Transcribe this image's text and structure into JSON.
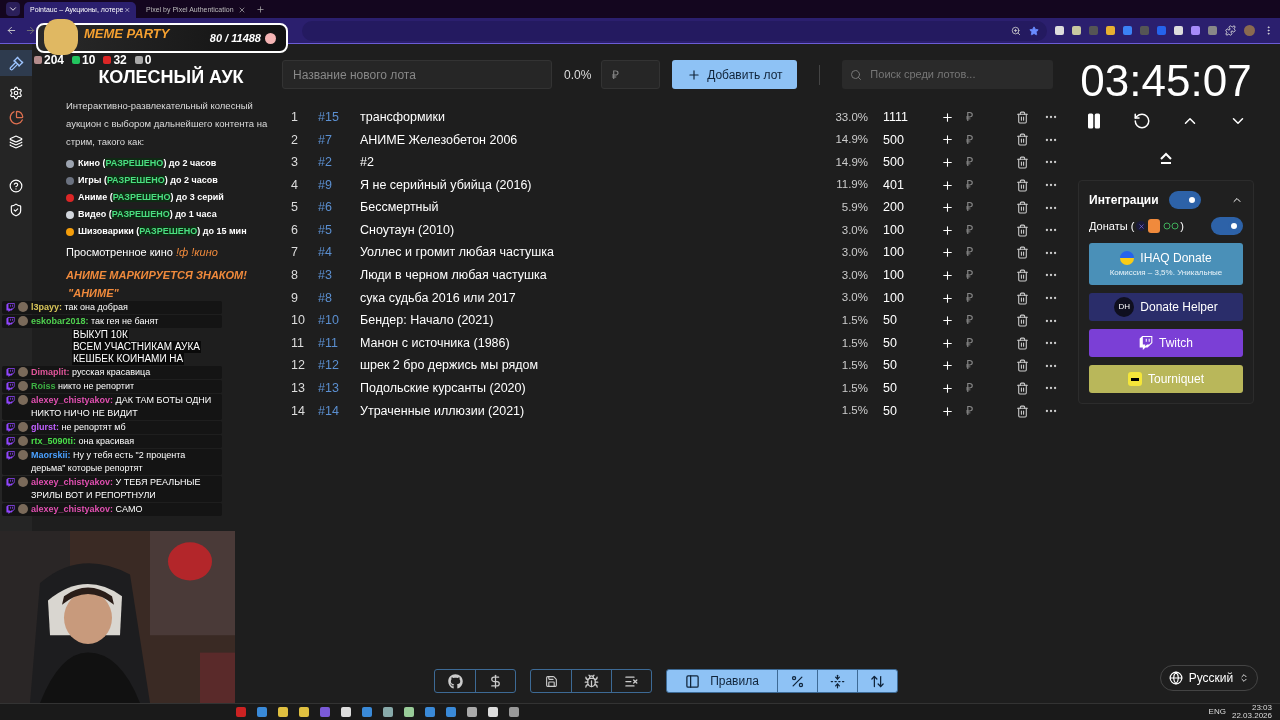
{
  "browser": {
    "tabs": [
      {
        "title": "Pointauc – Аукционы, лотере",
        "selected": true
      },
      {
        "title": "Pixel by Pixel Authentication",
        "selected": false
      }
    ]
  },
  "overlay": {
    "widget_title": "MEME PARTY",
    "widget_count": "80 / 11488",
    "stats": [
      "204",
      "10",
      "32",
      "0"
    ],
    "promo": [
      "ВЫКУП 10К",
      "ВСЕМ УЧАСТНИКАМ АУКА",
      "КЕШБЕК КОИНАМИ НА"
    ],
    "chat": [
      {
        "user": "l3payy:",
        "color": "#d9c65a",
        "text": "так она добрая"
      },
      {
        "user": "eskobar2018:",
        "color": "#4fcf4f",
        "text": "так гея не банят"
      },
      {
        "user": "Dimaplit:",
        "color": "#e0559a",
        "text": "русская красавица"
      },
      {
        "user": "Roiss",
        "color": "#3cb043",
        "text": "никто не репортит"
      },
      {
        "user": "alexey_chistyakov:",
        "color": "#e04fb0",
        "text": "ДАК ТАМ БОТЫ ОДНИ НИКТО НИЧО НЕ ВИДИТ"
      },
      {
        "user": "glurst:",
        "color": "#c060ff",
        "text": "не репортят мб"
      },
      {
        "user": "rtx_5090ti:",
        "color": "#4ade4a",
        "text": "она красивая"
      },
      {
        "user": "Maorskii:",
        "color": "#4aa0ff",
        "text": "Ну у тебя есть \"2 процента дерьма\" которые репортят"
      },
      {
        "user": "alexey_chistyakov:",
        "color": "#e04fb0",
        "text": "У ТЕБЯ РЕАЛЬНЫЕ ЗРИЛЫ ВОТ И РЕПОРТНУЛИ"
      },
      {
        "user": "alexey_chistyakov:",
        "color": "#e04fb0",
        "text": "САМО"
      }
    ]
  },
  "rules_panel": {
    "title": "КОЛЕСНЫЙ АУК",
    "intro": "Интерактивно-развлекательный колесный аукцион с выбором дальнейшего контента на стрим, такого как:",
    "items": [
      {
        "label": "Кино (",
        "status": "РАЗРЕШЕНО",
        "limit": ") до 2 часов",
        "color": "#9ca3af"
      },
      {
        "label": "Игры (",
        "status": "РАЗРЕШЕНО",
        "limit": ") до 2 часов",
        "color": "#6b7280"
      },
      {
        "label": "Аниме (",
        "status": "РАЗРЕШЕНО",
        "limit": ") до 3 серий",
        "color": "#dc2626"
      },
      {
        "label": "Видео (",
        "status": "РАЗРЕШЕНО",
        "limit": ") до 1 часа",
        "color": "#d1d5db"
      },
      {
        "label": "Шизоварики (",
        "status": "РАЗРЕШЕНО",
        "limit": ") до 15 мин",
        "color": "#f59e0b"
      }
    ],
    "watched_label": "Просмотренное кино",
    "commands": "!ф !кино",
    "anime_note": "АНИМЕ МАРКИРУЕТСЯ ЗНАКОМ!",
    "anime_mark": "\"АНИМЕ\""
  },
  "new_lot": {
    "placeholder": "Название нового лота",
    "percent": "0.0%",
    "amount_placeholder": "₽",
    "add_button": "Добавить лот",
    "search_placeholder": "Поиск среди лотов..."
  },
  "lots": [
    {
      "index": "1",
      "id": "#15",
      "name": "трансформики",
      "percent": "33.0%",
      "amount": "1111",
      "add_placeholder": "₽"
    },
    {
      "index": "2",
      "id": "#7",
      "name": "АНИМЕ Железобетон 2006",
      "percent": "14.9%",
      "amount": "500",
      "add_placeholder": "₽"
    },
    {
      "index": "3",
      "id": "#2",
      "name": "#2",
      "percent": "14.9%",
      "amount": "500",
      "add_placeholder": "₽"
    },
    {
      "index": "4",
      "id": "#9",
      "name": "Я не серийный убийца (2016)",
      "percent": "11.9%",
      "amount": "401",
      "add_placeholder": "₽"
    },
    {
      "index": "5",
      "id": "#6",
      "name": "Бессмертный",
      "percent": "5.9%",
      "amount": "200",
      "add_placeholder": "₽"
    },
    {
      "index": "6",
      "id": "#5",
      "name": "Сноутаун (2010)",
      "percent": "3.0%",
      "amount": "100",
      "add_placeholder": "₽"
    },
    {
      "index": "7",
      "id": "#4",
      "name": "Уоллес и громит любая частушка",
      "percent": "3.0%",
      "amount": "100",
      "add_placeholder": "₽"
    },
    {
      "index": "8",
      "id": "#3",
      "name": "Люди в черном любая частушка",
      "percent": "3.0%",
      "amount": "100",
      "add_placeholder": "₽"
    },
    {
      "index": "9",
      "id": "#8",
      "name": "сука судьба 2016 или 2017",
      "percent": "3.0%",
      "amount": "100",
      "add_placeholder": "₽"
    },
    {
      "index": "10",
      "id": "#10",
      "name": "Бендер: Начало (2021)",
      "percent": "1.5%",
      "amount": "50",
      "add_placeholder": "₽"
    },
    {
      "index": "11",
      "id": "#11",
      "name": "Манон с источника (1986)",
      "percent": "1.5%",
      "amount": "50",
      "add_placeholder": "₽"
    },
    {
      "index": "12",
      "id": "#12",
      "name": "шрек 2 бро держись мы рядом",
      "percent": "1.5%",
      "amount": "50",
      "add_placeholder": "₽"
    },
    {
      "index": "13",
      "id": "#13",
      "name": "Подольские курсанты (2020)",
      "percent": "1.5%",
      "amount": "50",
      "add_placeholder": "₽"
    },
    {
      "index": "14",
      "id": "#14",
      "name": "Утраченные иллюзии (2021)",
      "percent": "1.5%",
      "amount": "50",
      "add_placeholder": "₽"
    }
  ],
  "timer": "03:45:07",
  "integrations": {
    "title": "Интеграции",
    "on": true,
    "donations_label": "Донаты (",
    "donations_close": ")",
    "donations_on": true,
    "services": [
      {
        "kind": "ihaq",
        "label": "IHAQ Donate",
        "subtitle": "Комиссия – 3,5%. Уникальные"
      },
      {
        "kind": "donatehelper",
        "label": "Donate Helper",
        "icon_text": "DH"
      },
      {
        "kind": "twitch",
        "label": "Twitch"
      },
      {
        "kind": "tourniquet",
        "label": "Tourniquet"
      }
    ]
  },
  "toolbar": [
    {
      "highlighted": false,
      "buttons": [
        {
          "kind": "github"
        },
        {
          "kind": "dollar"
        }
      ]
    },
    {
      "highlighted": false,
      "buttons": [
        {
          "kind": "save"
        },
        {
          "kind": "bug"
        },
        {
          "kind": "clear"
        }
      ]
    },
    {
      "highlighted": true,
      "buttons": [
        {
          "kind": "rules",
          "label": "Правила"
        },
        {
          "kind": "percent"
        },
        {
          "kind": "fold"
        },
        {
          "kind": "sort"
        }
      ]
    }
  ],
  "language": "Русский",
  "taskbar": {
    "lang": "ENG",
    "time": "23:03",
    "date": "22.03.2026"
  }
}
